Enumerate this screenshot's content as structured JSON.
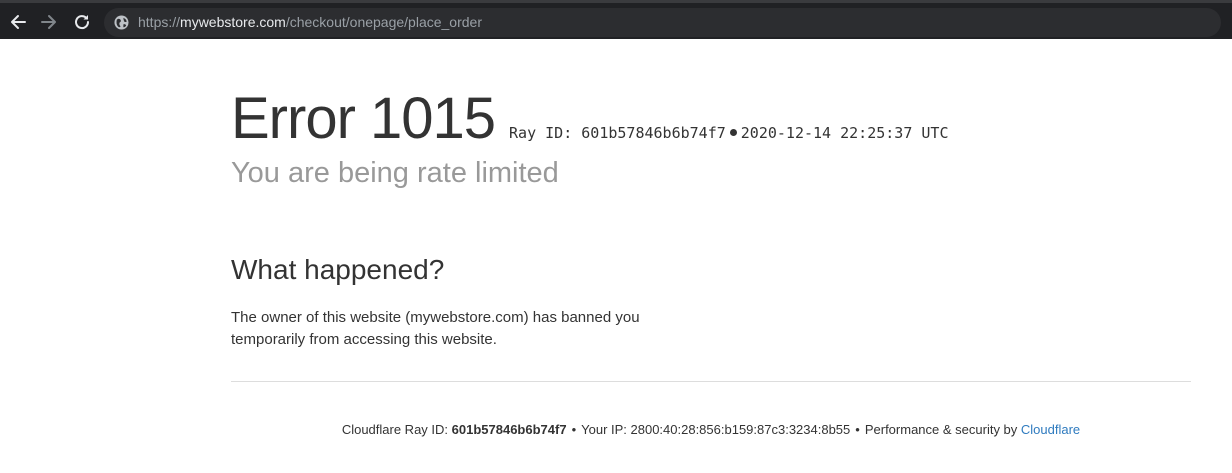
{
  "browser": {
    "url_scheme": "https://",
    "url_host": "mywebstore.com",
    "url_path": "/checkout/onepage/place_order"
  },
  "error": {
    "code_label": "Error 1015",
    "ray_label": "Ray ID: 601b57846b6b74f7",
    "timestamp": "2020-12-14 22:25:37 UTC",
    "subtitle": "You are being rate limited"
  },
  "section": {
    "heading": "What happened?",
    "body": "The owner of this website (mywebstore.com) has banned you temporarily from accessing this website."
  },
  "footer": {
    "ray_prefix": "Cloudflare Ray ID: ",
    "ray_id": "601b57846b6b74f7",
    "separator": "•",
    "ip_text": "Your IP: 2800:40:28:856:b159:87c3:3234:8b55",
    "perf_text": "Performance & security by ",
    "cloudflare_link": "Cloudflare"
  },
  "colors": {
    "browser_bar": "#202124",
    "omnibox": "#2c2d30",
    "link": "#2f7bbf",
    "text": "#333333",
    "muted": "#999999"
  }
}
